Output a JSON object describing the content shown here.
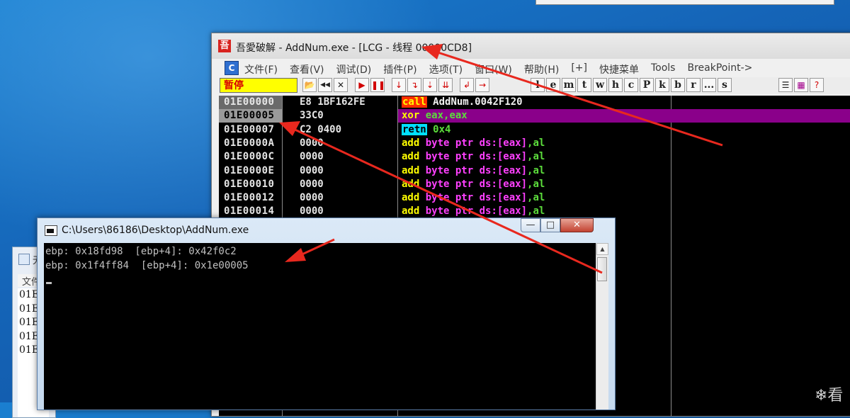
{
  "debugger": {
    "title": "吾愛破解 - AddNum.exe - [LCG - 线程 00000CD8]",
    "logo": "吾",
    "menu_icon": "C",
    "menu": [
      "文件(F)",
      "查看(V)",
      "调试(D)",
      "插件(P)",
      "选项(T)",
      "窗口(W)",
      "帮助(H)",
      "[+]",
      "快捷菜单",
      "Tools",
      "BreakPoint->"
    ],
    "status": "暂停",
    "toolbar_buttons": [
      "open-icon",
      "rewind-icon",
      "close-icon",
      "run-icon",
      "pause-icon",
      "step-into-icon",
      "step-over-icon",
      "trace-into-icon",
      "trace-over-icon",
      "execute-till-return-icon",
      "goto-icon"
    ],
    "view_buttons": [
      "l",
      "e",
      "m",
      "t",
      "w",
      "h",
      "c",
      "P",
      "k",
      "b",
      "r",
      "...",
      "s"
    ],
    "disasm": [
      {
        "addr": "01E00000",
        "hex": "E8 1BF162FE",
        "op": "call",
        "args": [
          {
            "t": "AddNum.0042F120",
            "c": "white"
          }
        ]
      },
      {
        "addr": "01E00005",
        "hex": "33C0",
        "op": "xor",
        "args": [
          {
            "t": "eax,eax",
            "c": "grn"
          }
        ]
      },
      {
        "addr": "01E00007",
        "hex": "C2 0400",
        "op": "retn",
        "args": [
          {
            "t": "0x4",
            "c": "grn"
          }
        ]
      },
      {
        "addr": "01E0000A",
        "hex": "0000",
        "op": "add",
        "args": [
          {
            "t": "byte ptr ds:[eax]",
            "c": "mag"
          },
          {
            "t": ",al",
            "c": "grn"
          }
        ]
      },
      {
        "addr": "01E0000C",
        "hex": "0000",
        "op": "add",
        "args": [
          {
            "t": "byte ptr ds:[eax]",
            "c": "mag"
          },
          {
            "t": ",al",
            "c": "grn"
          }
        ]
      },
      {
        "addr": "01E0000E",
        "hex": "0000",
        "op": "add",
        "args": [
          {
            "t": "byte ptr ds:[eax]",
            "c": "mag"
          },
          {
            "t": ",al",
            "c": "grn"
          }
        ]
      },
      {
        "addr": "01E00010",
        "hex": "0000",
        "op": "add",
        "args": [
          {
            "t": "byte ptr ds:[eax]",
            "c": "mag"
          },
          {
            "t": ",al",
            "c": "grn"
          }
        ]
      },
      {
        "addr": "01E00012",
        "hex": "0000",
        "op": "add",
        "args": [
          {
            "t": "byte ptr ds:[eax]",
            "c": "mag"
          },
          {
            "t": ",al",
            "c": "grn"
          }
        ]
      },
      {
        "addr": "01E00014",
        "hex": "0000",
        "op": "add",
        "args": [
          {
            "t": "byte ptr ds:[eax]",
            "c": "mag"
          },
          {
            "t": ",al",
            "c": "grn"
          }
        ]
      }
    ]
  },
  "small_window": {
    "title": "无",
    "menu": "文件",
    "rows": [
      "01E",
      "01E",
      "01E",
      "01E",
      "01E"
    ]
  },
  "console": {
    "title": "C:\\Users\\86186\\Desktop\\AddNum.exe",
    "minimize_label": "—",
    "maximize_label": "□",
    "close_label": "✕",
    "lines": [
      "ebp: 0x18fd98  [ebp+4]: 0x42f0c2",
      "ebp: 0x1f4ff84  [ebp+4]: 0x1e00005"
    ]
  },
  "colors": {
    "annotation_arrow": "#e8281e",
    "call_bg": "#ff2d00",
    "highlight_row": "#8a008a",
    "retn_bg": "#00e0ff"
  },
  "watermark": "❄看"
}
